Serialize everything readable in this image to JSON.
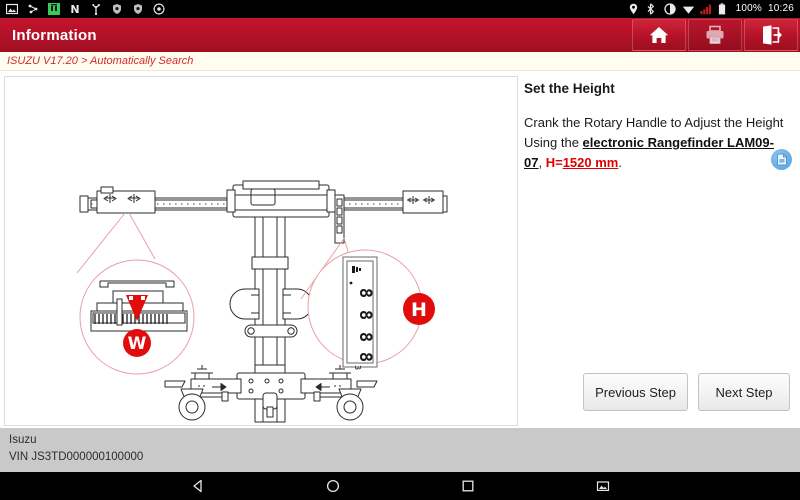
{
  "statusbar": {
    "left_icons": [
      {
        "name": "screenshot-icon"
      },
      {
        "name": "usb-debug-icon"
      },
      {
        "name": "android-app-icon"
      },
      {
        "name": "network-n-icon"
      },
      {
        "name": "usb-icon"
      },
      {
        "name": "shield-icon-1"
      },
      {
        "name": "shield-icon-2"
      },
      {
        "name": "settings-gear-icon"
      }
    ],
    "right_icons": [
      {
        "name": "location-pin-icon"
      },
      {
        "name": "bluetooth-icon"
      },
      {
        "name": "contrast-icon"
      },
      {
        "name": "wifi-icon"
      },
      {
        "name": "signal-bars-icon"
      },
      {
        "name": "battery-icon"
      }
    ],
    "battery_percent": "100%",
    "clock": "10:26"
  },
  "appbar": {
    "title": "Information",
    "buttons": [
      {
        "name": "home-button",
        "icon": "home-icon",
        "enabled": true
      },
      {
        "name": "print-button",
        "icon": "printer-icon",
        "enabled": false
      },
      {
        "name": "exit-button",
        "icon": "exit-icon",
        "enabled": true
      }
    ]
  },
  "breadcrumb": {
    "text": "ISUZU V17.20 > Automatically Search"
  },
  "image_panel": {
    "name": "headlamp-aimer-diagram",
    "callouts": [
      {
        "label": "W",
        "description": "horizontal scale magnified view"
      },
      {
        "label": "H",
        "description": "electronic rangefinder display magnified view"
      }
    ],
    "display_digits": "8888"
  },
  "instruction": {
    "heading": "Set the Height",
    "body_part1": "Crank the Rotary Handle to Adjust the Height Using the ",
    "body_bold": "electronic Rangefinder LAM09-07",
    "body_part2": ", ",
    "body_red_label": "H=",
    "body_red_value": "1520 mm",
    "body_part3": "."
  },
  "note_button": {
    "name": "note-document-button",
    "icon": "document-icon"
  },
  "step_buttons": {
    "previous": "Previous Step",
    "next": "Next Step"
  },
  "footer": {
    "vehicle": "Isuzu",
    "vin": "VIN JS3TD000000100000"
  },
  "navbar": {
    "items": [
      {
        "name": "nav-back-icon"
      },
      {
        "name": "nav-home-icon"
      },
      {
        "name": "nav-recents-icon"
      },
      {
        "name": "nav-screenshot-icon"
      }
    ]
  },
  "colors": {
    "brand_red": "#b5122a",
    "accent_red": "#e00000",
    "breadcrumb_bg": "#fffdf0",
    "footer_bg": "#c9c9c9"
  }
}
